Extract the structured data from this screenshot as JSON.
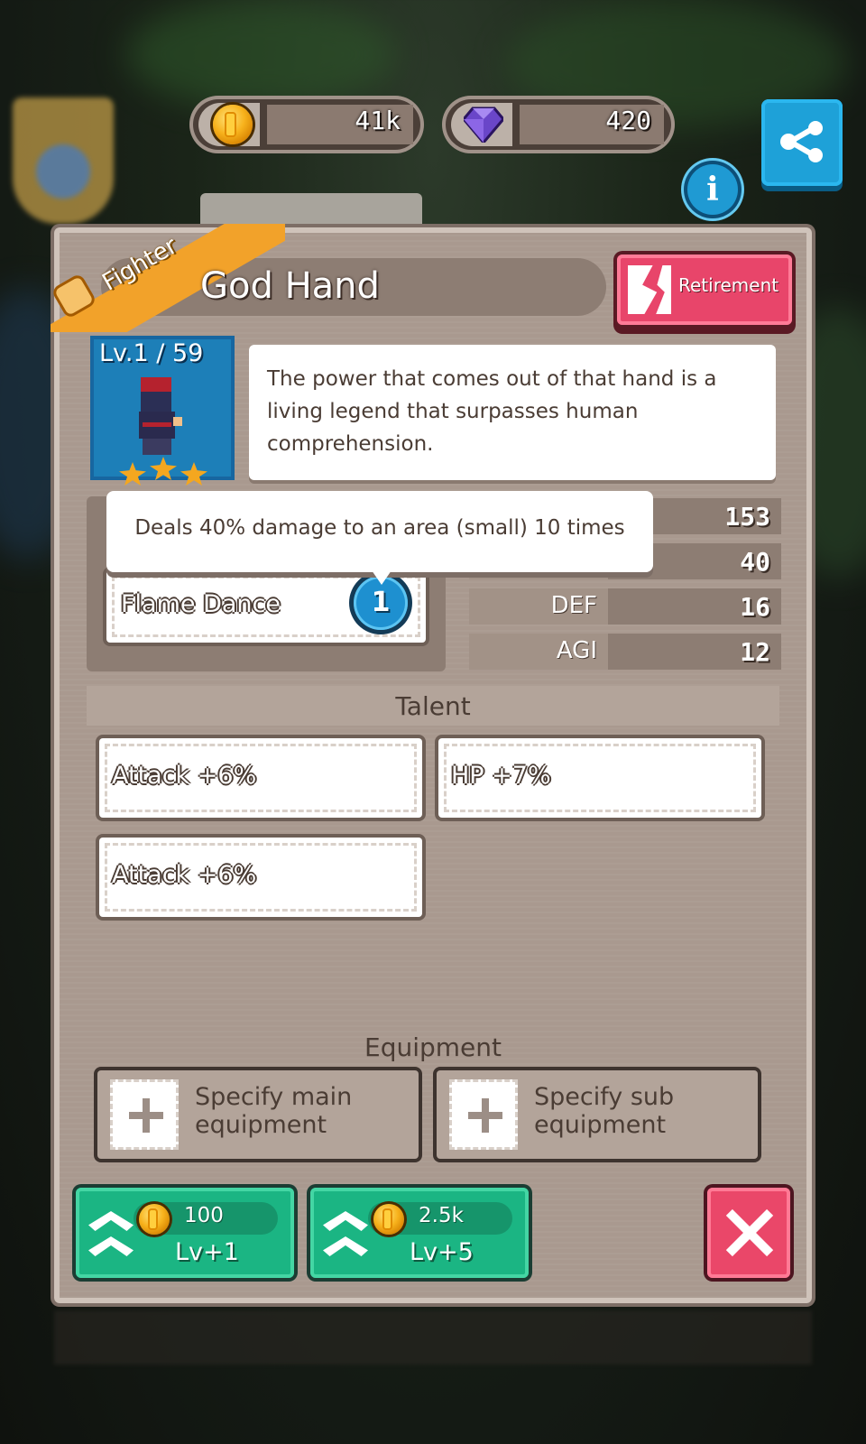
{
  "currency": {
    "gold": "41k",
    "gems": "420"
  },
  "hero": {
    "class_label": "Fighter",
    "name": "God Hand",
    "level_text": "Lv.1 / 59",
    "stars": 3,
    "description": "The power that comes out of that hand is a living legend that surpasses human comprehension."
  },
  "buttons": {
    "retirement": "Retirement"
  },
  "skill": {
    "name": "Flame Dance",
    "level": "1",
    "tooltip": "Deals 40% damage to an area (small) 10 times"
  },
  "stats": [
    {
      "label": "",
      "value": "153"
    },
    {
      "label": "",
      "value": "40"
    },
    {
      "label": "DEF",
      "value": "16"
    },
    {
      "label": "AGI",
      "value": "12"
    }
  ],
  "talent": {
    "title": "Talent",
    "items": [
      "Attack +6%",
      "HP +7%",
      "Attack +6%"
    ]
  },
  "equipment": {
    "title": "Equipment",
    "main": "Specify main equipment",
    "sub": "Specify sub equipment"
  },
  "level_up": [
    {
      "cost": "100",
      "label": "Lv+1"
    },
    {
      "cost": "2.5k",
      "label": "Lv+5"
    }
  ],
  "colors": {
    "panel": "#a9998f",
    "accent_green": "#1bb583",
    "accent_red": "#ea4769",
    "accent_blue": "#1ea1d8",
    "ribbon": "#f2a22a"
  },
  "icons": [
    "coin-icon",
    "gem-icon",
    "share-icon",
    "info-icon",
    "fist-icon",
    "retirement-icon",
    "plus-icon",
    "level-up-chevron-icon",
    "close-icon"
  ]
}
